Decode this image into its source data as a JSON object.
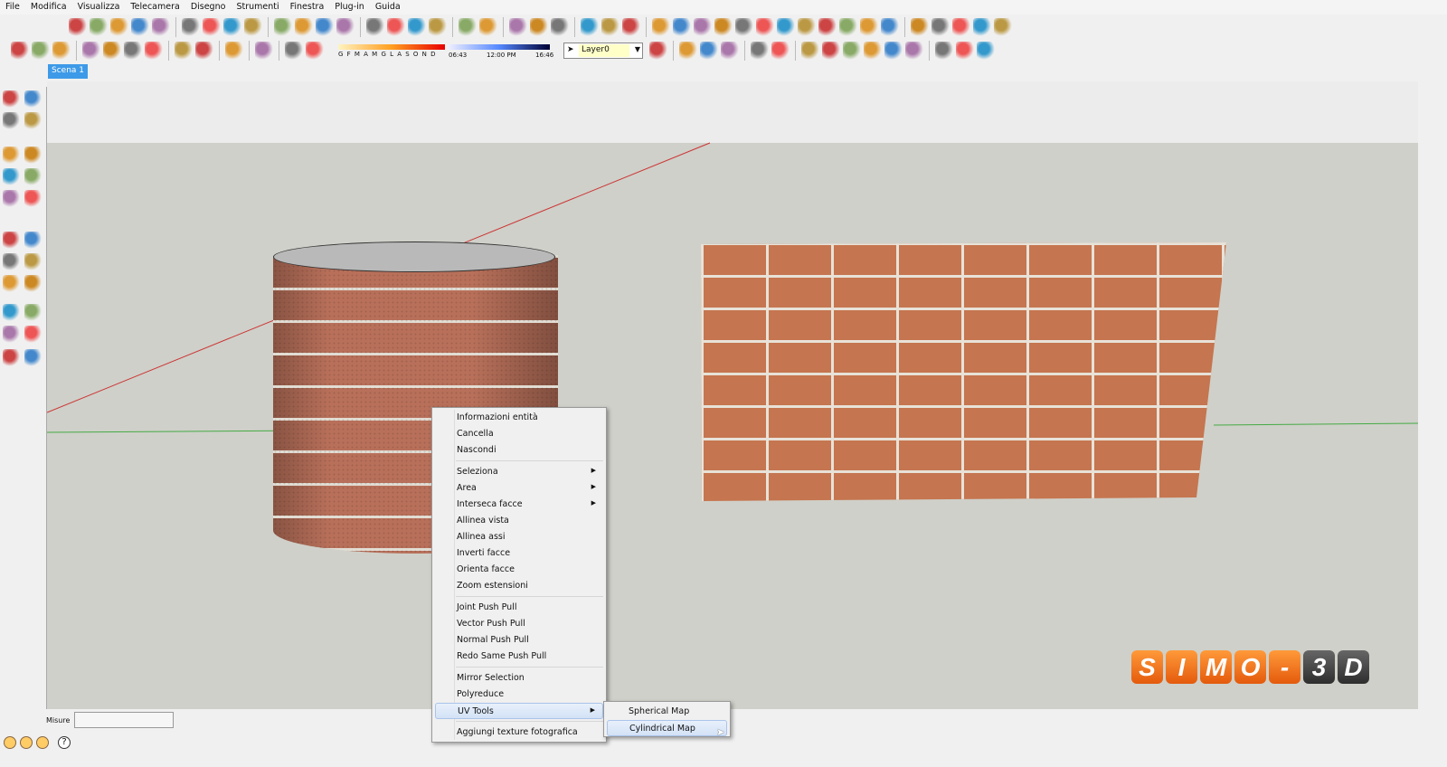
{
  "menu": [
    "File",
    "Modifica",
    "Visualizza",
    "Telecamera",
    "Disegno",
    "Strumenti",
    "Finestra",
    "Plug-in",
    "Guida"
  ],
  "toolbar1": [
    "select-icon",
    "pencil-icon",
    "rectangle-icon",
    "circle-icon",
    "arc-icon",
    "|",
    "paint-bucket-icon",
    "eraser-icon",
    "tape-measure-icon",
    "paint-icon",
    "|",
    "push-pull-icon",
    "move-icon",
    "rotate-icon",
    "follow-me-icon",
    "|",
    "orbit-icon",
    "pan-icon",
    "zoom-icon",
    "zoom-extents-icon",
    "|",
    "section-icon",
    "section-display-icon",
    "|",
    "building-icon",
    "add-location-icon",
    "google-earth-icon",
    "|",
    "get-models-icon",
    "share-model-icon",
    "component-icon",
    "|",
    "bezier-icon",
    "curve-icon",
    "spline-icon",
    "polyline-icon",
    "line-icon",
    "arc2-icon",
    "rect2-icon",
    "spiral-icon",
    "arc3-icon",
    "curve2-icon",
    "curve3-icon",
    "arc4-icon",
    "|",
    "zigzag-icon",
    "polygon-icon",
    "wrench-icon",
    "ellipse-icon",
    "shape-icon"
  ],
  "toolbar2": [
    "new-icon",
    "open-icon",
    "save-icon",
    "|",
    "cut-icon",
    "copy-icon",
    "paste-icon",
    "delete-icon",
    "|",
    "undo-icon",
    "redo-icon",
    "|",
    "print-icon",
    "|",
    "info-icon",
    "|",
    "shadow-info-icon",
    "shadow-icon"
  ],
  "shadows": {
    "months": "G F M A M G L A S O N D",
    "time_start": "06:43",
    "time_mid": "12:00 PM",
    "time_end": "16:46"
  },
  "layer": {
    "value": "Layer0"
  },
  "toolbar3": [
    "layer-manager-icon",
    "|",
    "axis-x-icon",
    "axis-y-icon",
    "axis-n-icon",
    "|",
    "rotate-x-icon",
    "rotate-y-icon",
    "|",
    "cube-icon",
    "box-icon",
    "pyramid-icon",
    "trident-icon",
    "knife-icon",
    "stack-icon",
    "|",
    "cube-yellow-icon",
    "cube-gray-icon",
    "cube-green-icon"
  ],
  "scene_tab": "Scena 1",
  "context_menu": {
    "items": [
      {
        "label": "Informazioni entità"
      },
      {
        "label": "Cancella"
      },
      {
        "label": "Nascondi"
      },
      {
        "sep": true
      },
      {
        "label": "Seleziona",
        "sub": true
      },
      {
        "label": "Area",
        "sub": true
      },
      {
        "label": "Interseca facce",
        "sub": true
      },
      {
        "label": "Allinea vista"
      },
      {
        "label": "Allinea assi"
      },
      {
        "label": "Inverti facce"
      },
      {
        "label": "Orienta facce"
      },
      {
        "label": "Zoom estensioni"
      },
      {
        "sep": true
      },
      {
        "label": "Joint Push Pull"
      },
      {
        "label": "Vector Push Pull"
      },
      {
        "label": "Normal Push Pull"
      },
      {
        "label": "Redo Same Push Pull"
      },
      {
        "sep": true
      },
      {
        "label": "Mirror Selection"
      },
      {
        "label": "Polyreduce"
      },
      {
        "label": "UV Tools",
        "sub": true,
        "hl": true
      },
      {
        "sep": true
      },
      {
        "label": "Aggiungi texture fotografica"
      }
    ]
  },
  "submenu": {
    "items": [
      "Spherical Map",
      "Cylindrical Map"
    ]
  },
  "status": {
    "measure_label": "Misure",
    "measure_value": ""
  },
  "logo": [
    "S",
    "I",
    "M",
    "O",
    "-",
    "3",
    "D"
  ]
}
